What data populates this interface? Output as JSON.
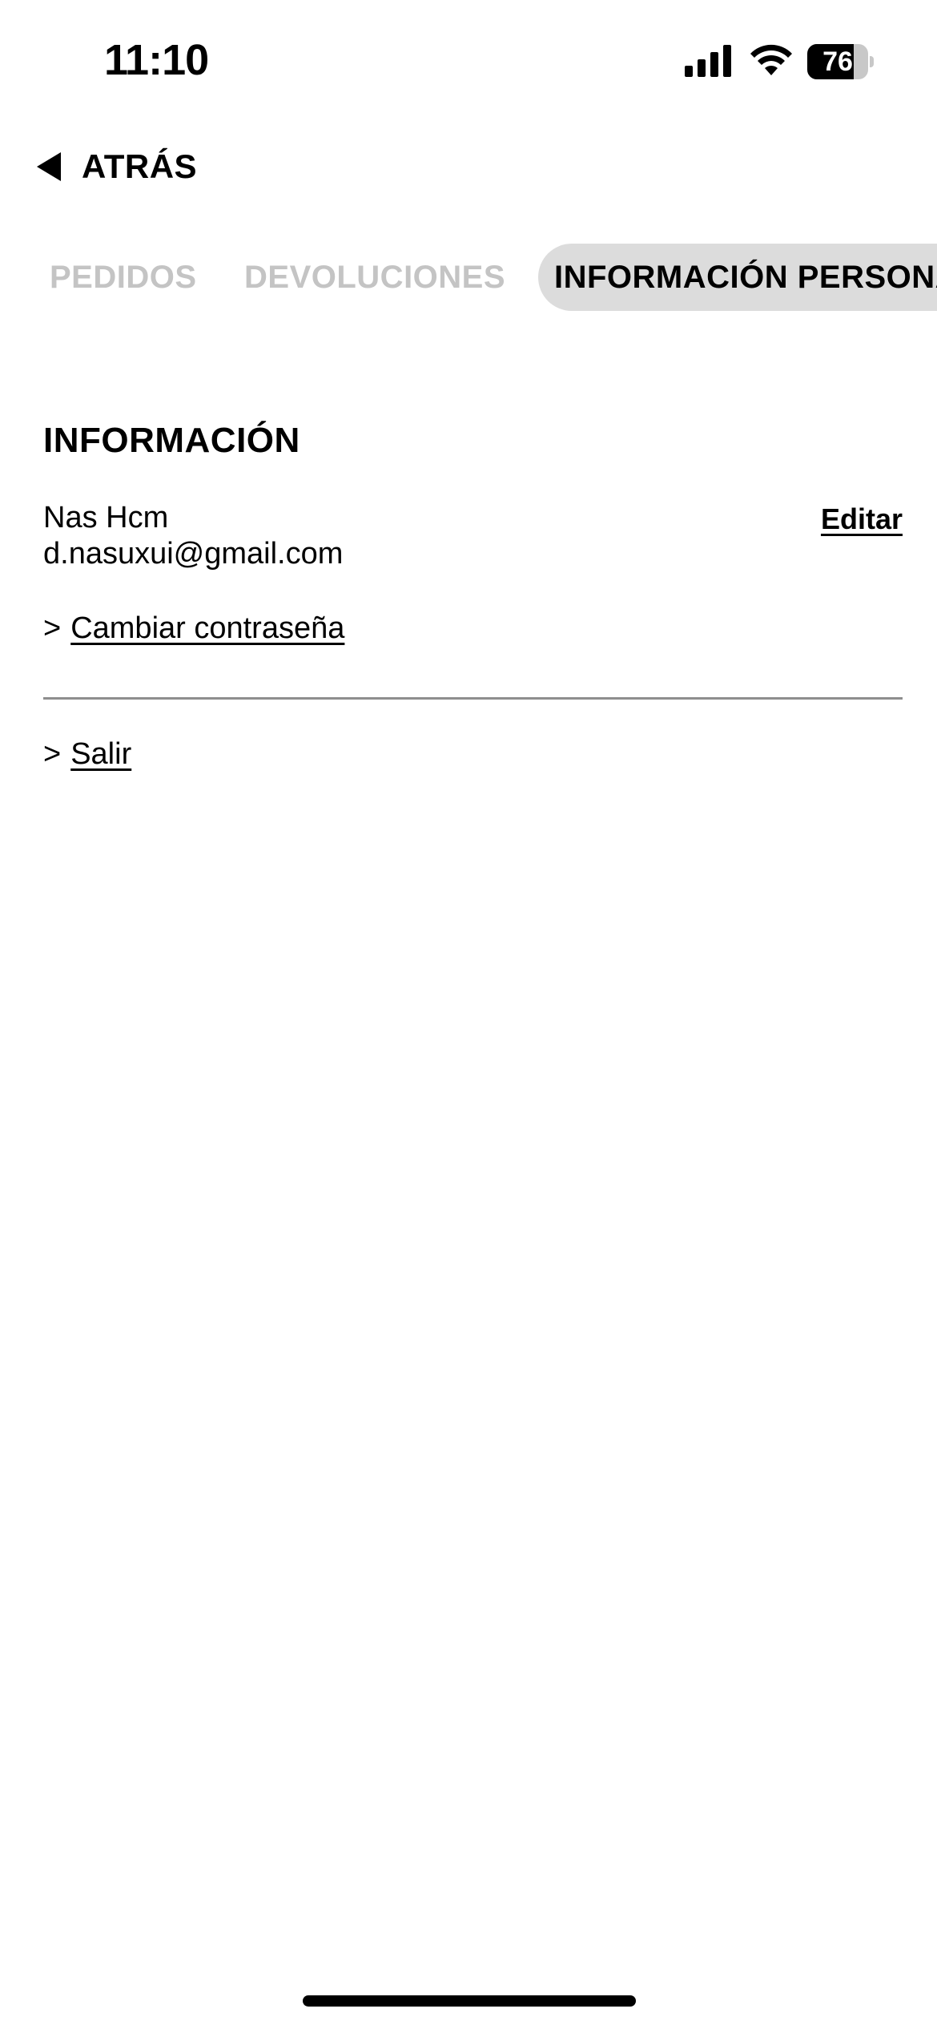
{
  "status_bar": {
    "time": "11:10",
    "battery_level": "76",
    "battery_fraction": 0.76,
    "icons": [
      "signal-icon",
      "wifi-icon",
      "battery-icon"
    ]
  },
  "navigation": {
    "back_label": "ATRÁS",
    "back_icon": "back-arrow-icon"
  },
  "tabs": [
    {
      "label": "PEDIDOS",
      "selected": false
    },
    {
      "label": "DEVOLUCIONES",
      "selected": false
    },
    {
      "label": "INFORMACIÓN PERSONAL",
      "selected": true
    }
  ],
  "info": {
    "title": "INFORMACIÓN",
    "name": "Nas Hcm",
    "email": "d.nasuxui@gmail.com",
    "edit_label": "Editar",
    "change_password_prefix": ">",
    "change_password_label": "Cambiar contraseña",
    "logout_prefix": ">",
    "logout_label": "Salir"
  },
  "colors": {
    "text": "#000000",
    "inactive_tab": "#c4c4c4",
    "selected_tab_bg": "#dcdcdc",
    "divider": "#8e8e8e",
    "background": "#ffffff"
  }
}
